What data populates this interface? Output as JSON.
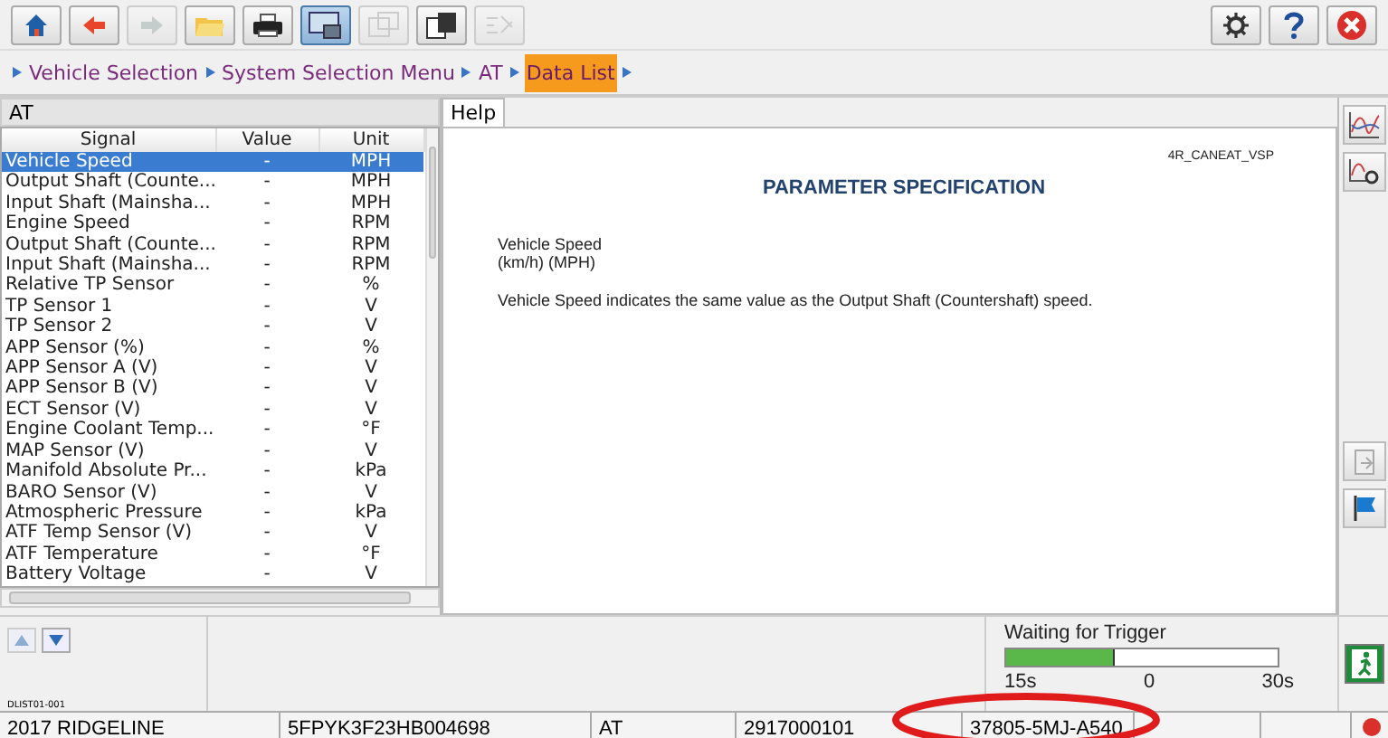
{
  "toolbar": {
    "buttons": [
      {
        "kind": "home",
        "disabled": false,
        "selected": false
      },
      {
        "kind": "back",
        "disabled": false,
        "selected": false
      },
      {
        "kind": "forward",
        "disabled": true,
        "selected": false
      },
      {
        "kind": "folder",
        "disabled": false,
        "selected": false
      },
      {
        "kind": "print",
        "disabled": false,
        "selected": false
      },
      {
        "kind": "screen",
        "disabled": false,
        "selected": true
      },
      {
        "kind": "window",
        "disabled": true,
        "selected": false
      },
      {
        "kind": "windows",
        "disabled": false,
        "selected": false
      },
      {
        "kind": "chart",
        "disabled": true,
        "selected": false
      }
    ],
    "right_buttons": [
      {
        "kind": "settings"
      },
      {
        "kind": "help"
      },
      {
        "kind": "close"
      }
    ]
  },
  "breadcrumb": [
    {
      "label": "Vehicle Selection",
      "selected": false
    },
    {
      "label": "System Selection Menu",
      "selected": false
    },
    {
      "label": "AT",
      "selected": false
    },
    {
      "label": "Data List",
      "selected": true
    }
  ],
  "list_panel": {
    "title": "AT",
    "columns": [
      "Signal",
      "Value",
      "Unit"
    ],
    "rows": [
      {
        "signal": "Vehicle Speed",
        "value": "-",
        "unit": "MPH",
        "selected": true
      },
      {
        "signal": "Output Shaft (Counte...",
        "value": "-",
        "unit": "MPH",
        "selected": false
      },
      {
        "signal": "Input Shaft (Mainsha...",
        "value": "-",
        "unit": "MPH",
        "selected": false
      },
      {
        "signal": "Engine Speed",
        "value": "-",
        "unit": "RPM",
        "selected": false
      },
      {
        "signal": "Output Shaft (Counte...",
        "value": "-",
        "unit": "RPM",
        "selected": false
      },
      {
        "signal": "Input Shaft (Mainsha...",
        "value": "-",
        "unit": "RPM",
        "selected": false
      },
      {
        "signal": "Relative TP Sensor",
        "value": "-",
        "unit": "%",
        "selected": false
      },
      {
        "signal": "TP Sensor 1",
        "value": "-",
        "unit": "V",
        "selected": false
      },
      {
        "signal": "TP Sensor 2",
        "value": "-",
        "unit": "V",
        "selected": false
      },
      {
        "signal": "APP Sensor (%)",
        "value": "-",
        "unit": "%",
        "selected": false
      },
      {
        "signal": "APP Sensor A (V)",
        "value": "-",
        "unit": "V",
        "selected": false
      },
      {
        "signal": "APP Sensor B (V)",
        "value": "-",
        "unit": "V",
        "selected": false
      },
      {
        "signal": "ECT Sensor (V)",
        "value": "-",
        "unit": "V",
        "selected": false
      },
      {
        "signal": "Engine Coolant Temp...",
        "value": "-",
        "unit": "°F",
        "selected": false
      },
      {
        "signal": "MAP Sensor (V)",
        "value": "-",
        "unit": "V",
        "selected": false
      },
      {
        "signal": "Manifold Absolute Pr...",
        "value": "-",
        "unit": "kPa",
        "selected": false
      },
      {
        "signal": "BARO Sensor (V)",
        "value": "-",
        "unit": "V",
        "selected": false
      },
      {
        "signal": "Atmospheric Pressure",
        "value": "-",
        "unit": "kPa",
        "selected": false
      },
      {
        "signal": "ATF Temp Sensor (V)",
        "value": "-",
        "unit": "V",
        "selected": false
      },
      {
        "signal": "ATF Temperature",
        "value": "-",
        "unit": "°F",
        "selected": false
      },
      {
        "signal": "Battery Voltage",
        "value": "-",
        "unit": "V",
        "selected": false
      }
    ]
  },
  "help_panel": {
    "tab": "Help",
    "code": "4R_CANEAT_VSP",
    "heading": "PARAMETER SPECIFICATION",
    "name": "Vehicle Speed",
    "units": "(km/h) (MPH)",
    "description": "Vehicle Speed indicates the same value as the Output Shaft (Countershaft) speed."
  },
  "side_tools": [
    {
      "kind": "graph"
    },
    {
      "kind": "graph-settings"
    },
    {
      "kind": "export"
    },
    {
      "kind": "flag"
    }
  ],
  "bottom": {
    "screen_id": "DLIST01-001",
    "nav": [
      {
        "kind": "up",
        "disabled": true
      },
      {
        "kind": "down",
        "disabled": false
      }
    ],
    "trigger": {
      "label": "Waiting for Trigger",
      "level": 0.4,
      "ticks": [
        "15s",
        "0",
        "30s"
      ]
    },
    "exit": {
      "kind": "exit"
    }
  },
  "status_bar": [
    "2017 RIDGELINE",
    "5FPYK3F23HB004698",
    "AT",
    "2917000101",
    "37805-5MJ-A540"
  ]
}
